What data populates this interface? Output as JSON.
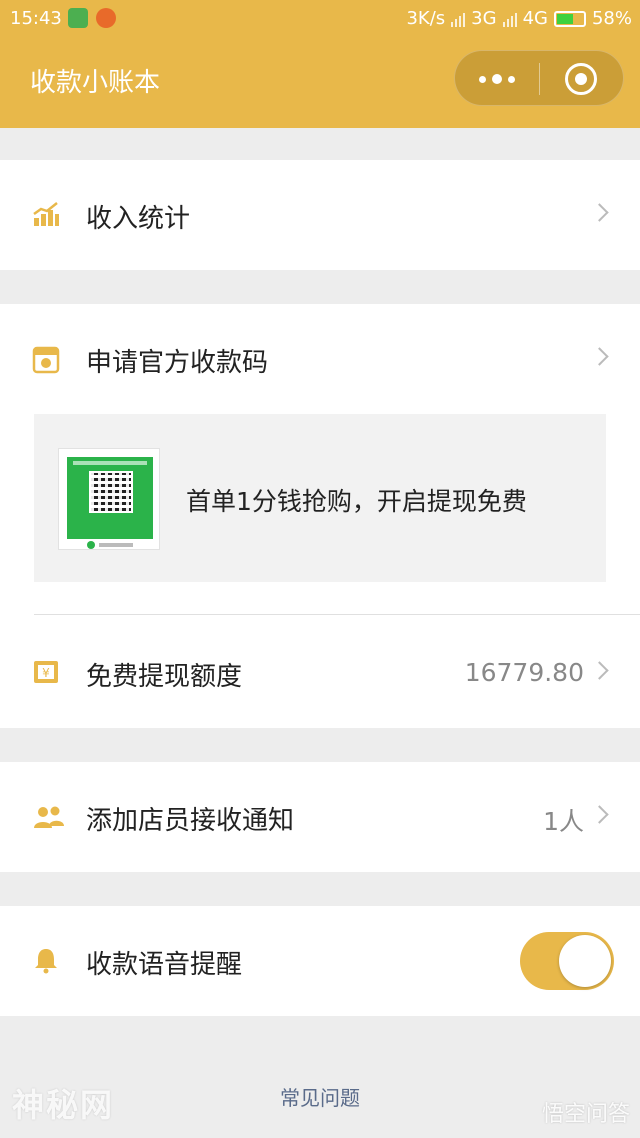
{
  "status_bar": {
    "time": "15:43",
    "speed": "3K/s",
    "net1": "3G",
    "net2": "4G",
    "battery": "58%"
  },
  "header": {
    "title": "收款小账本",
    "color": "#e8b84a"
  },
  "menu": {
    "income_stats": {
      "label": "收入统计",
      "icon": "bar-chart-icon"
    },
    "official_code": {
      "label": "申请官方收款码",
      "icon": "qr-card-icon",
      "promo_text": "首单1分钱抢购，开启提现免费"
    },
    "free_quota": {
      "label": "免费提现额度",
      "value": "16779.80",
      "icon": "yuan-receipt-icon"
    },
    "add_staff": {
      "label": "添加店员接收通知",
      "value": "1人",
      "icon": "staff-icon"
    },
    "voice_alert": {
      "label": "收款语音提醒",
      "icon": "bell-icon",
      "enabled": true
    }
  },
  "footer": {
    "faq": "常见问题"
  },
  "watermarks": {
    "left": "神秘网",
    "right": "悟空问答"
  }
}
